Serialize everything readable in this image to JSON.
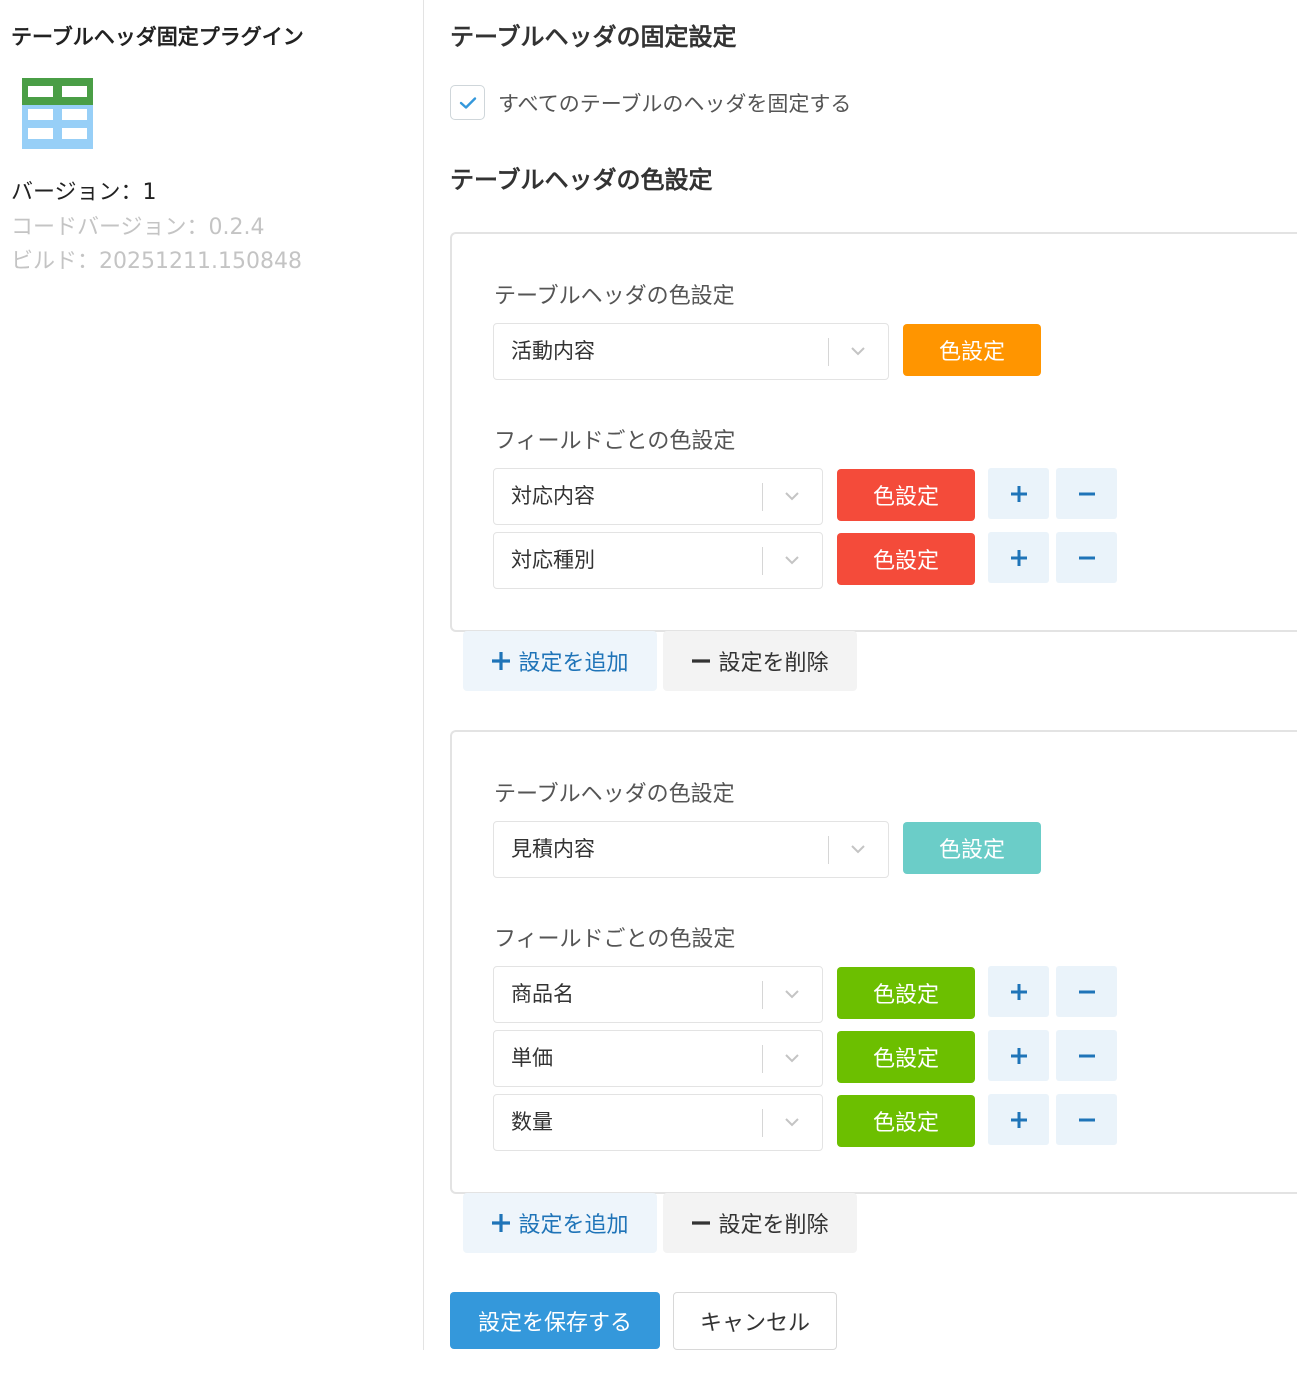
{
  "sidebar": {
    "plugin_name": "テーブルヘッダ固定プラグイン",
    "icon": "table-icon",
    "version": "バージョン：1",
    "code_version": "コードバージョン：0.2.4",
    "build": "ビルド：20251211.150848"
  },
  "main": {
    "fixed_title": "テーブルヘッダの固定設定",
    "fix_all_label": "すべてのテーブルのヘッダを固定する",
    "fix_all_checked": true,
    "color_title": "テーブルヘッダの色設定",
    "groups": [
      {
        "table_label": "テーブルヘッダの色設定",
        "table_value": "活動内容",
        "table_color_label": "色設定",
        "table_color": "#ff9500",
        "fields_label": "フィールドごとの色設定",
        "fields": [
          {
            "value": "対応内容",
            "color_label": "色設定",
            "color": "#f44b3a"
          },
          {
            "value": "対応種別",
            "color_label": "色設定",
            "color": "#f44b3a"
          }
        ],
        "add_label": "設定を追加",
        "delete_label": "設定を削除"
      },
      {
        "table_label": "テーブルヘッダの色設定",
        "table_value": "見積内容",
        "table_color_label": "色設定",
        "table_color": "#6bcdc8",
        "fields_label": "フィールドごとの色設定",
        "fields": [
          {
            "value": "商品名",
            "color_label": "色設定",
            "color": "#6cbf00"
          },
          {
            "value": "単価",
            "color_label": "色設定",
            "color": "#6cbf00"
          },
          {
            "value": "数量",
            "color_label": "色設定",
            "color": "#6cbf00"
          }
        ],
        "add_label": "設定を追加",
        "delete_label": "設定を削除"
      }
    ],
    "save_label": "設定を保存する",
    "cancel_label": "キャンセル"
  },
  "colors": {
    "accent": "#3498db",
    "icon_blue": "#1f74b8"
  }
}
